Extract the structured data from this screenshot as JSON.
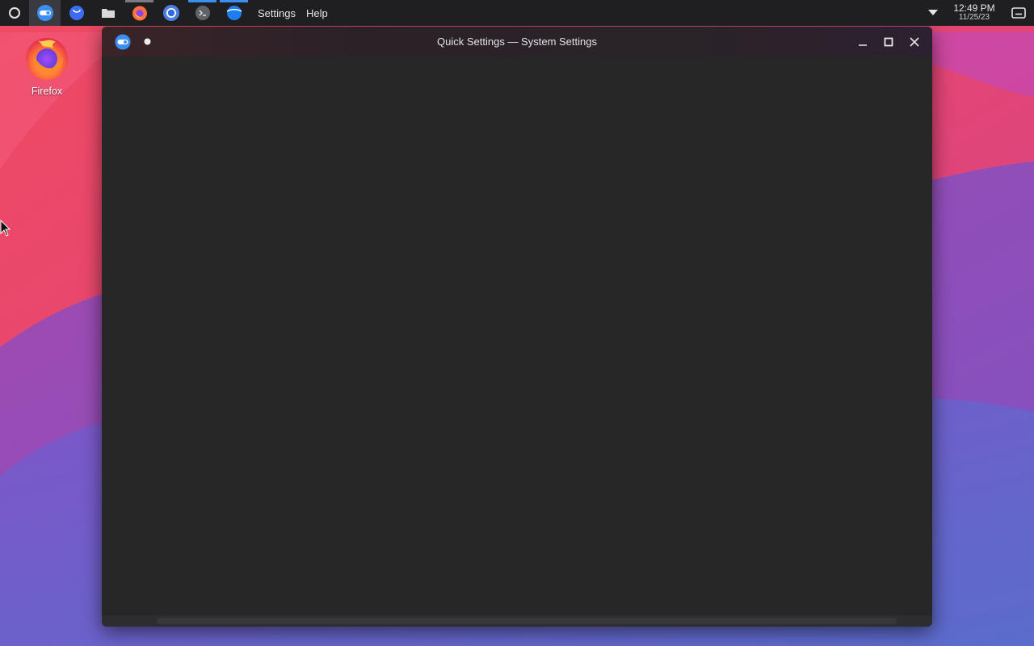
{
  "panel": {
    "launcher_icon": "app-launcher-icon",
    "tasks": [
      {
        "icon": "system-settings-icon",
        "active": true
      },
      {
        "icon": "discover-icon",
        "active": false
      },
      {
        "icon": "file-manager-icon",
        "active": false
      },
      {
        "icon": "firefox-icon",
        "active": false
      },
      {
        "icon": "chromium-icon",
        "active": false
      },
      {
        "icon": "terminal-icon",
        "active": false
      },
      {
        "icon": "browser-icon",
        "active": false
      }
    ],
    "menu": {
      "settings_label": "Settings",
      "help_label": "Help"
    },
    "clock": {
      "time": "12:49 PM",
      "date": "11/25/23"
    }
  },
  "desktop": {
    "icons": [
      {
        "label": "Firefox",
        "icon": "firefox-icon"
      }
    ]
  },
  "window": {
    "title": "Quick Settings — System Settings",
    "controls": [
      "minimize-icon",
      "maximize-icon",
      "close-icon"
    ]
  },
  "colors": {
    "panel_bg": "#1f1f22",
    "window_bg": "#272727",
    "accent": "#3b8ef2"
  }
}
